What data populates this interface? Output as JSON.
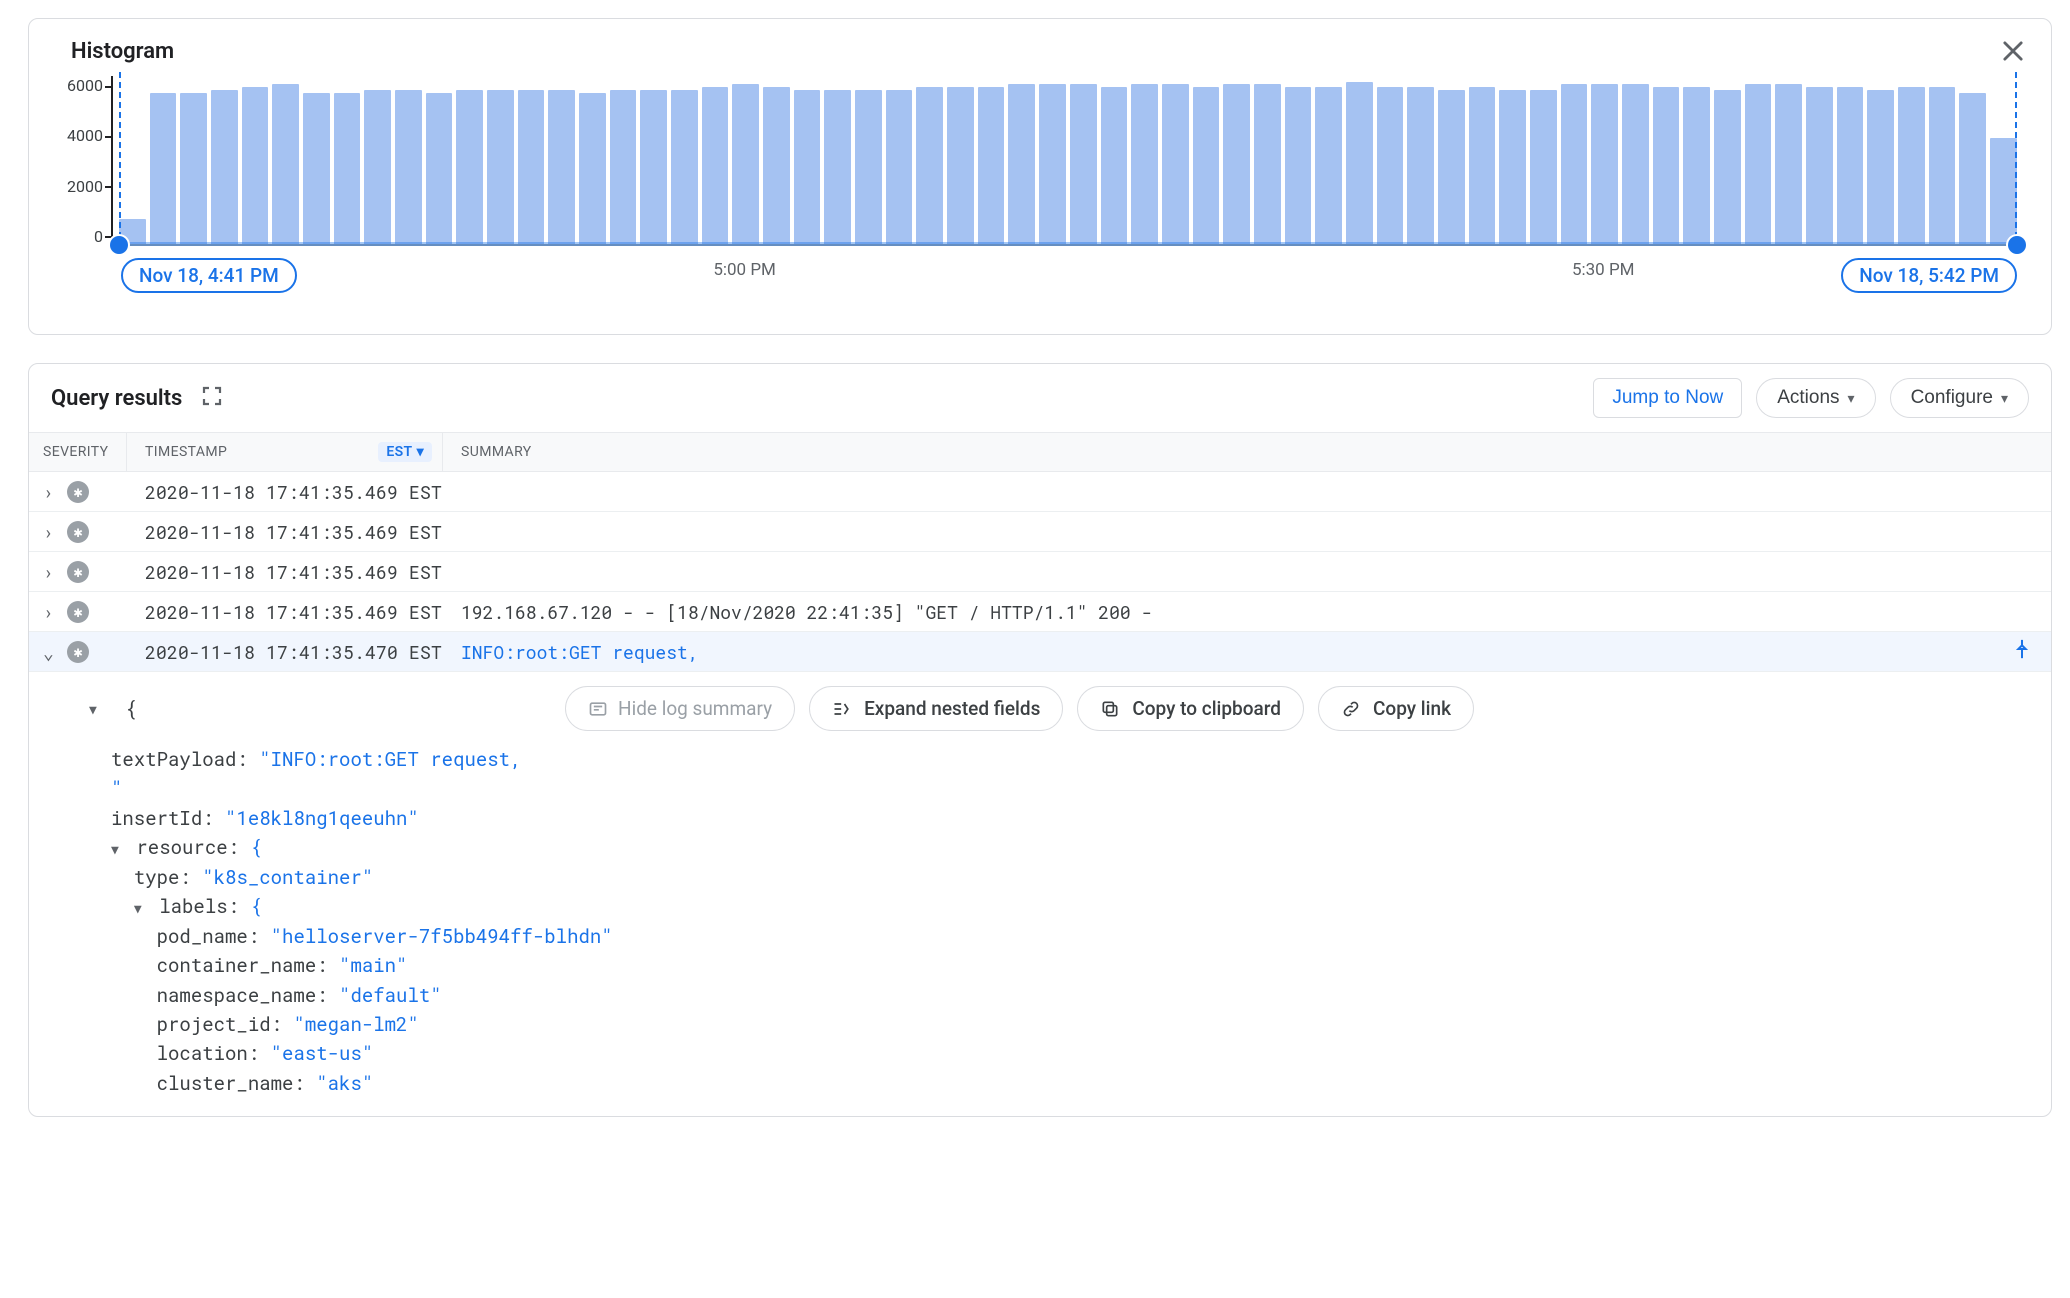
{
  "histogram": {
    "title": "Histogram",
    "y_ticks": [
      "6000",
      "4000",
      "2000",
      "0"
    ],
    "x_ticks": [
      {
        "label": "5:00 PM",
        "pos": 33
      },
      {
        "label": "5:30 PM",
        "pos": 78
      }
    ],
    "range_start": "Nov 18, 4:41 PM",
    "range_end": "Nov 18, 5:42 PM"
  },
  "chart_data": {
    "type": "bar",
    "title": "Histogram",
    "xlabel": "",
    "ylabel": "",
    "ylim": [
      0,
      6000
    ],
    "categories": [
      "4:41",
      "4:42",
      "4:43",
      "4:44",
      "4:45",
      "4:46",
      "4:47",
      "4:48",
      "4:49",
      "4:50",
      "4:51",
      "4:52",
      "4:53",
      "4:54",
      "4:55",
      "4:56",
      "4:57",
      "4:58",
      "4:59",
      "5:00",
      "5:01",
      "5:02",
      "5:03",
      "5:04",
      "5:05",
      "5:06",
      "5:07",
      "5:08",
      "5:09",
      "5:10",
      "5:11",
      "5:12",
      "5:13",
      "5:14",
      "5:15",
      "5:16",
      "5:17",
      "5:18",
      "5:19",
      "5:20",
      "5:21",
      "5:22",
      "5:23",
      "5:24",
      "5:25",
      "5:26",
      "5:27",
      "5:28",
      "5:29",
      "5:30",
      "5:31",
      "5:32",
      "5:33",
      "5:34",
      "5:35",
      "5:36",
      "5:37",
      "5:38",
      "5:39",
      "5:40",
      "5:41",
      "5:42"
    ],
    "values": [
      900,
      5400,
      5400,
      5500,
      5600,
      5700,
      5400,
      5400,
      5500,
      5500,
      5400,
      5500,
      5500,
      5500,
      5500,
      5400,
      5500,
      5500,
      5500,
      5600,
      5700,
      5600,
      5500,
      5500,
      5500,
      5500,
      5600,
      5600,
      5600,
      5700,
      5700,
      5700,
      5600,
      5700,
      5700,
      5600,
      5700,
      5700,
      5600,
      5600,
      5800,
      5600,
      5600,
      5500,
      5600,
      5500,
      5500,
      5700,
      5700,
      5700,
      5600,
      5600,
      5500,
      5700,
      5700,
      5600,
      5600,
      5500,
      5600,
      5600,
      5400,
      3800
    ]
  },
  "results": {
    "title": "Query results",
    "jump_label": "Jump to Now",
    "actions_label": "Actions",
    "configure_label": "Configure",
    "cols": {
      "severity": "Severity",
      "timestamp": "Timestamp",
      "summary": "Summary"
    },
    "tz_chip": "EST",
    "rows": [
      {
        "ts": "2020-11-18 17:41:35.469 EST",
        "summary": "",
        "expanded": false
      },
      {
        "ts": "2020-11-18 17:41:35.469 EST",
        "summary": "",
        "expanded": false
      },
      {
        "ts": "2020-11-18 17:41:35.469 EST",
        "summary": "",
        "expanded": false
      },
      {
        "ts": "2020-11-18 17:41:35.469 EST",
        "summary": "192.168.67.120 - - [18/Nov/2020 22:41:35] \"GET / HTTP/1.1\" 200 -",
        "expanded": false
      },
      {
        "ts": "2020-11-18 17:41:35.470 EST",
        "summary": "INFO:root:GET request,",
        "expanded": true
      }
    ],
    "detail_buttons": {
      "hide": "Hide log summary",
      "expand": "Expand nested fields",
      "copy": "Copy to clipboard",
      "link": "Copy link"
    },
    "detail_json": {
      "textPayload": "\"INFO:root:GET request,\n\"",
      "insertId": "\"1e8kl8ng1qeeuhn\"",
      "resource": {
        "type": "\"k8s_container\"",
        "labels": {
          "pod_name": "\"helloserver-7f5bb494ff-blhdn\"",
          "container_name": "\"main\"",
          "namespace_name": "\"default\"",
          "project_id": "\"megan-lm2\"",
          "location": "\"east-us\"",
          "cluster_name": "\"aks\""
        }
      }
    }
  }
}
